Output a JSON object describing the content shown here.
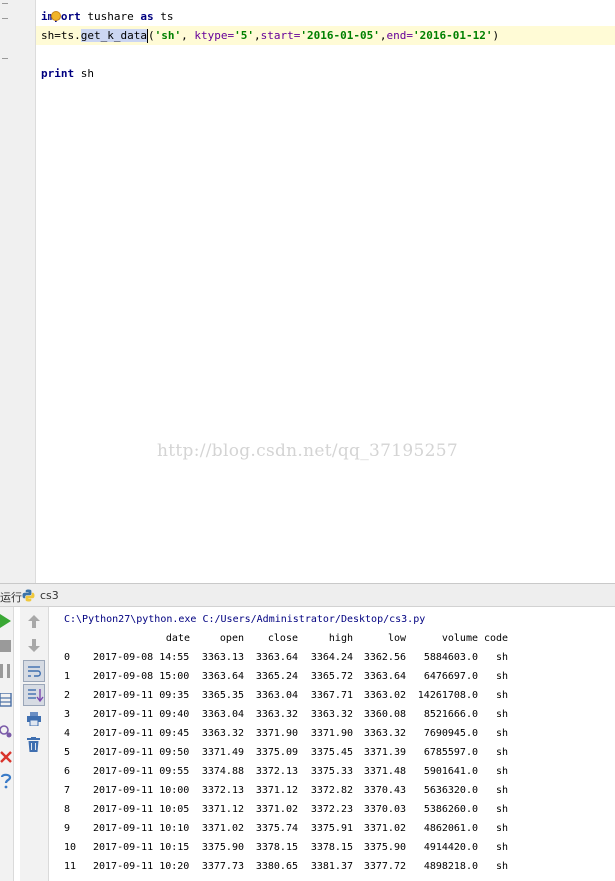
{
  "editor": {
    "line1": {
      "kw": "import",
      "rest": " tushare ",
      "kw2": "as",
      "rest2": " ts"
    },
    "line2": {
      "prefix": "sh=ts.",
      "selected": "get_k_data",
      "open": "(",
      "arg1": "'sh'",
      "sep1": ", ",
      "kw_ktype": "ktype=",
      "arg2": "'5'",
      "sep2": ",",
      "kw_start": "start=",
      "arg3": "'2016-01-05'",
      "sep3": ",",
      "kw_end": "end=",
      "arg4": "'2016-01-12'",
      "close": ")"
    },
    "line3": {
      "kw": "print",
      "rest": " sh"
    }
  },
  "watermark": "http://blog.csdn.net/qq_37195257",
  "run_panel": {
    "label": "运行",
    "config_name": "cs3",
    "command": "C:\\Python27\\python.exe C:/Users/Administrator/Desktop/cs3.py",
    "headers": {
      "date": "date",
      "open": "open",
      "close": "close",
      "high": "high",
      "low": "low",
      "volume": "volume",
      "code": "code"
    },
    "rows": [
      {
        "idx": "0",
        "date": "2017-09-08 14:55",
        "open": "3363.13",
        "close": "3363.64",
        "high": "3364.24",
        "low": "3362.56",
        "volume": "5884603.0",
        "code": "sh"
      },
      {
        "idx": "1",
        "date": "2017-09-08 15:00",
        "open": "3363.64",
        "close": "3365.24",
        "high": "3365.72",
        "low": "3363.64",
        "volume": "6476697.0",
        "code": "sh"
      },
      {
        "idx": "2",
        "date": "2017-09-11 09:35",
        "open": "3365.35",
        "close": "3363.04",
        "high": "3367.71",
        "low": "3363.02",
        "volume": "14261708.0",
        "code": "sh"
      },
      {
        "idx": "3",
        "date": "2017-09-11 09:40",
        "open": "3363.04",
        "close": "3363.32",
        "high": "3363.32",
        "low": "3360.08",
        "volume": "8521666.0",
        "code": "sh"
      },
      {
        "idx": "4",
        "date": "2017-09-11 09:45",
        "open": "3363.32",
        "close": "3371.90",
        "high": "3371.90",
        "low": "3363.32",
        "volume": "7690945.0",
        "code": "sh"
      },
      {
        "idx": "5",
        "date": "2017-09-11 09:50",
        "open": "3371.49",
        "close": "3375.09",
        "high": "3375.45",
        "low": "3371.39",
        "volume": "6785597.0",
        "code": "sh"
      },
      {
        "idx": "6",
        "date": "2017-09-11 09:55",
        "open": "3374.88",
        "close": "3372.13",
        "high": "3375.33",
        "low": "3371.48",
        "volume": "5901641.0",
        "code": "sh"
      },
      {
        "idx": "7",
        "date": "2017-09-11 10:00",
        "open": "3372.13",
        "close": "3371.12",
        "high": "3372.82",
        "low": "3370.43",
        "volume": "5636320.0",
        "code": "sh"
      },
      {
        "idx": "8",
        "date": "2017-09-11 10:05",
        "open": "3371.12",
        "close": "3371.02",
        "high": "3372.23",
        "low": "3370.03",
        "volume": "5386260.0",
        "code": "sh"
      },
      {
        "idx": "9",
        "date": "2017-09-11 10:10",
        "open": "3371.02",
        "close": "3375.74",
        "high": "3375.91",
        "low": "3371.02",
        "volume": "4862061.0",
        "code": "sh"
      },
      {
        "idx": "10",
        "date": "2017-09-11 10:15",
        "open": "3375.90",
        "close": "3378.15",
        "high": "3378.15",
        "low": "3375.90",
        "volume": "4914420.0",
        "code": "sh"
      },
      {
        "idx": "11",
        "date": "2017-09-11 10:20",
        "open": "3377.73",
        "close": "3380.65",
        "high": "3381.37",
        "low": "3377.72",
        "volume": "4898218.0",
        "code": "sh"
      }
    ]
  },
  "icons": {
    "left_toolbar": [
      "run-icon",
      "stop-icon",
      "pause-icon",
      "layout-icon",
      "debug-icon",
      "close-icon",
      "help-icon"
    ],
    "mid_toolbar": [
      "arrow-up-icon",
      "arrow-down-icon",
      "soft-wrap-icon",
      "scroll-to-end-icon",
      "print-icon",
      "trash-icon"
    ]
  },
  "colors": {
    "keyword": "#000080",
    "string": "#008000",
    "kwarg": "#660099",
    "selection": "#ccd6f2",
    "current_line": "#fffbd6",
    "console_command": "#000080"
  }
}
